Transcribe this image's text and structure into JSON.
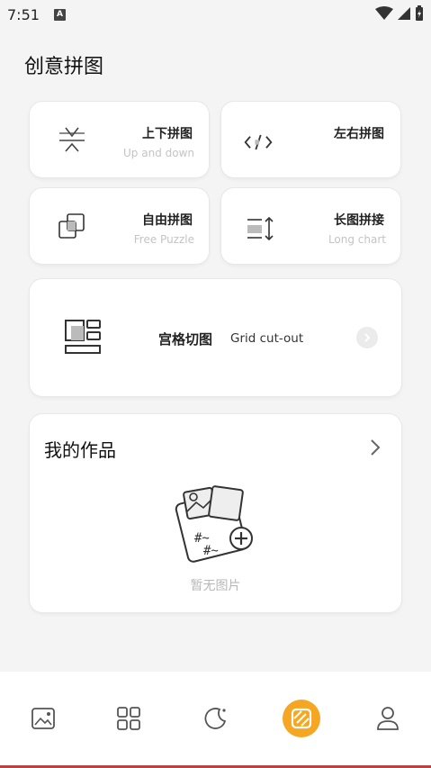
{
  "status_bar": {
    "time": "7:51",
    "notification_badge": "A"
  },
  "page": {
    "title": "创意拼图"
  },
  "tiles": [
    {
      "title": "上下拼图",
      "subtitle": "Up and down",
      "icon": "vertical-collage-icon"
    },
    {
      "title": "左右拼图",
      "subtitle": "",
      "icon": "horizontal-collage-icon"
    },
    {
      "title": "自由拼图",
      "subtitle": "Free Puzzle",
      "icon": "free-puzzle-icon"
    },
    {
      "title": "长图拼接",
      "subtitle": "Long chart",
      "icon": "long-image-icon"
    }
  ],
  "grid_cut": {
    "title": "宫格切图",
    "subtitle": "Grid cut-out",
    "icon": "grid-cut-icon"
  },
  "works": {
    "title": "我的作品",
    "empty_text": "暂无图片"
  },
  "bottom_nav": [
    {
      "icon": "image-icon",
      "active": false
    },
    {
      "icon": "apps-icon",
      "active": false
    },
    {
      "icon": "moon-icon",
      "active": false
    },
    {
      "icon": "collage-icon",
      "active": true
    },
    {
      "icon": "profile-icon",
      "active": false
    }
  ],
  "colors": {
    "accent": "#f5a623",
    "background": "#f4f4f4",
    "card": "#ffffff",
    "subtle_text": "#c4c4c4"
  }
}
